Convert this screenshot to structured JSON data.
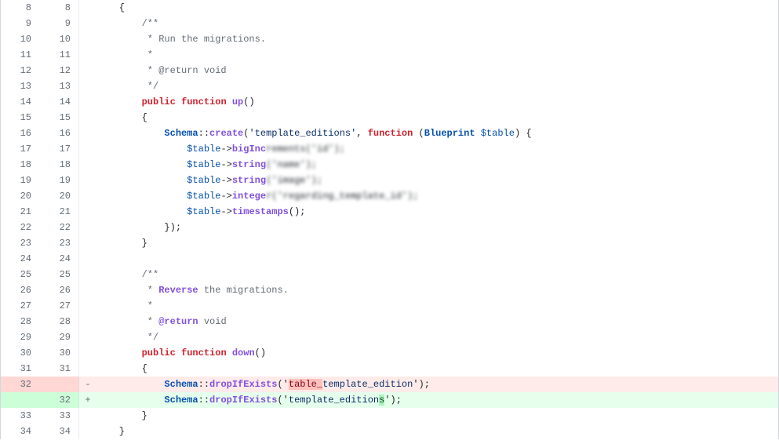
{
  "rows": [
    {
      "o": "8",
      "n": "8",
      "t": "ctx",
      "seg": [
        [
          "pun",
          "    {"
        ]
      ]
    },
    {
      "o": "9",
      "n": "9",
      "t": "ctx",
      "seg": [
        [
          "cmt",
          "        /**"
        ]
      ]
    },
    {
      "o": "10",
      "n": "10",
      "t": "ctx",
      "seg": [
        [
          "cmt",
          "         * Run the migrations."
        ]
      ]
    },
    {
      "o": "11",
      "n": "11",
      "t": "ctx",
      "seg": [
        [
          "cmt",
          "         *"
        ]
      ]
    },
    {
      "o": "12",
      "n": "12",
      "t": "ctx",
      "seg": [
        [
          "cmt",
          "         * @return void"
        ]
      ]
    },
    {
      "o": "13",
      "n": "13",
      "t": "ctx",
      "seg": [
        [
          "cmt",
          "         */"
        ]
      ]
    },
    {
      "o": "14",
      "n": "14",
      "t": "ctx",
      "seg": [
        [
          "pun",
          "        "
        ],
        [
          "kw",
          "public"
        ],
        [
          "pun",
          " "
        ],
        [
          "kw",
          "function"
        ],
        [
          "pun",
          " "
        ],
        [
          "fn",
          "up"
        ],
        [
          "pun",
          "()"
        ]
      ]
    },
    {
      "o": "15",
      "n": "15",
      "t": "ctx",
      "seg": [
        [
          "pun",
          "        {"
        ]
      ]
    },
    {
      "o": "16",
      "n": "16",
      "t": "ctx",
      "seg": [
        [
          "pun",
          "            "
        ],
        [
          "cls",
          "Schema"
        ],
        [
          "pun",
          "::"
        ],
        [
          "fn",
          "create"
        ],
        [
          "pun",
          "("
        ],
        [
          "str",
          "'template_editions'"
        ],
        [
          "pun",
          ", "
        ],
        [
          "kw",
          "function"
        ],
        [
          "pun",
          " ("
        ],
        [
          "cls",
          "Blueprint"
        ],
        [
          "pun",
          " "
        ],
        [
          "var",
          "$table"
        ],
        [
          "pun",
          ") {"
        ]
      ]
    },
    {
      "o": "17",
      "n": "17",
      "t": "ctx",
      "seg": [
        [
          "pun",
          "                "
        ],
        [
          "var",
          "$table"
        ],
        [
          "pun",
          "->"
        ],
        [
          "fn",
          "bigInc"
        ],
        [
          "blur",
          "rements('id');"
        ],
        [
          "pun",
          ""
        ]
      ]
    },
    {
      "o": "18",
      "n": "18",
      "t": "ctx",
      "seg": [
        [
          "pun",
          "                "
        ],
        [
          "var",
          "$table"
        ],
        [
          "pun",
          "->"
        ],
        [
          "fn",
          "string"
        ],
        [
          "blur",
          "('name');"
        ],
        [
          "pun",
          ""
        ]
      ]
    },
    {
      "o": "19",
      "n": "19",
      "t": "ctx",
      "seg": [
        [
          "pun",
          "                "
        ],
        [
          "var",
          "$table"
        ],
        [
          "pun",
          "->"
        ],
        [
          "fn",
          "string"
        ],
        [
          "blur",
          "('image');"
        ],
        [
          "pun",
          ""
        ]
      ]
    },
    {
      "o": "20",
      "n": "20",
      "t": "ctx",
      "seg": [
        [
          "pun",
          "                "
        ],
        [
          "var",
          "$table"
        ],
        [
          "pun",
          "->"
        ],
        [
          "fn",
          "intege"
        ],
        [
          "blur",
          "r('regarding_template_id');"
        ],
        [
          "pun",
          ""
        ]
      ]
    },
    {
      "o": "21",
      "n": "21",
      "t": "ctx",
      "seg": [
        [
          "pun",
          "                "
        ],
        [
          "var",
          "$table"
        ],
        [
          "pun",
          "->"
        ],
        [
          "fn",
          "timestamps"
        ],
        [
          "pun",
          "();"
        ]
      ]
    },
    {
      "o": "22",
      "n": "22",
      "t": "ctx",
      "seg": [
        [
          "pun",
          "            });"
        ]
      ]
    },
    {
      "o": "23",
      "n": "23",
      "t": "ctx",
      "seg": [
        [
          "pun",
          "        }"
        ]
      ]
    },
    {
      "o": "24",
      "n": "24",
      "t": "ctx",
      "seg": [
        [
          "pun",
          ""
        ]
      ]
    },
    {
      "o": "25",
      "n": "25",
      "t": "ctx",
      "seg": [
        [
          "cmt",
          "        /**"
        ]
      ]
    },
    {
      "o": "26",
      "n": "26",
      "t": "ctx",
      "seg": [
        [
          "cmt",
          "         * "
        ],
        [
          "fn",
          "Reverse"
        ],
        [
          "cmt",
          " the migrations."
        ]
      ]
    },
    {
      "o": "27",
      "n": "27",
      "t": "ctx",
      "seg": [
        [
          "cmt",
          "         *"
        ]
      ]
    },
    {
      "o": "28",
      "n": "28",
      "t": "ctx",
      "seg": [
        [
          "cmt",
          "         * "
        ],
        [
          "fn",
          "@return"
        ],
        [
          "cmt",
          " void"
        ]
      ]
    },
    {
      "o": "29",
      "n": "29",
      "t": "ctx",
      "seg": [
        [
          "cmt",
          "         */"
        ]
      ]
    },
    {
      "o": "30",
      "n": "30",
      "t": "ctx",
      "seg": [
        [
          "pun",
          "        "
        ],
        [
          "kw",
          "public"
        ],
        [
          "pun",
          " "
        ],
        [
          "kw",
          "function"
        ],
        [
          "pun",
          " "
        ],
        [
          "fn",
          "down"
        ],
        [
          "pun",
          "()"
        ]
      ]
    },
    {
      "o": "31",
      "n": "31",
      "t": "ctx",
      "seg": [
        [
          "pun",
          "        {"
        ]
      ]
    },
    {
      "o": "32",
      "n": "",
      "t": "del",
      "seg": [
        [
          "pun",
          "            "
        ],
        [
          "cls",
          "Schema"
        ],
        [
          "pun",
          "::"
        ],
        [
          "fn",
          "dropIfExists"
        ],
        [
          "pun",
          "('"
        ],
        [
          "strdel",
          "table_"
        ],
        [
          "str",
          "template_edition"
        ],
        [
          "pun",
          "');"
        ]
      ]
    },
    {
      "o": "",
      "n": "32",
      "t": "add",
      "seg": [
        [
          "pun",
          "            "
        ],
        [
          "cls",
          "Schema"
        ],
        [
          "pun",
          "::"
        ],
        [
          "fn",
          "dropIfExists"
        ],
        [
          "pun",
          "('"
        ],
        [
          "str",
          "template_edition"
        ],
        [
          "stradd",
          "s"
        ],
        [
          "pun",
          "');"
        ]
      ]
    },
    {
      "o": "33",
      "n": "33",
      "t": "ctx",
      "seg": [
        [
          "pun",
          "        }"
        ]
      ]
    },
    {
      "o": "34",
      "n": "34",
      "t": "ctx",
      "seg": [
        [
          "pun",
          "    }"
        ]
      ]
    }
  ],
  "markers": {
    "ctx": " ",
    "del": "-",
    "add": "+"
  }
}
